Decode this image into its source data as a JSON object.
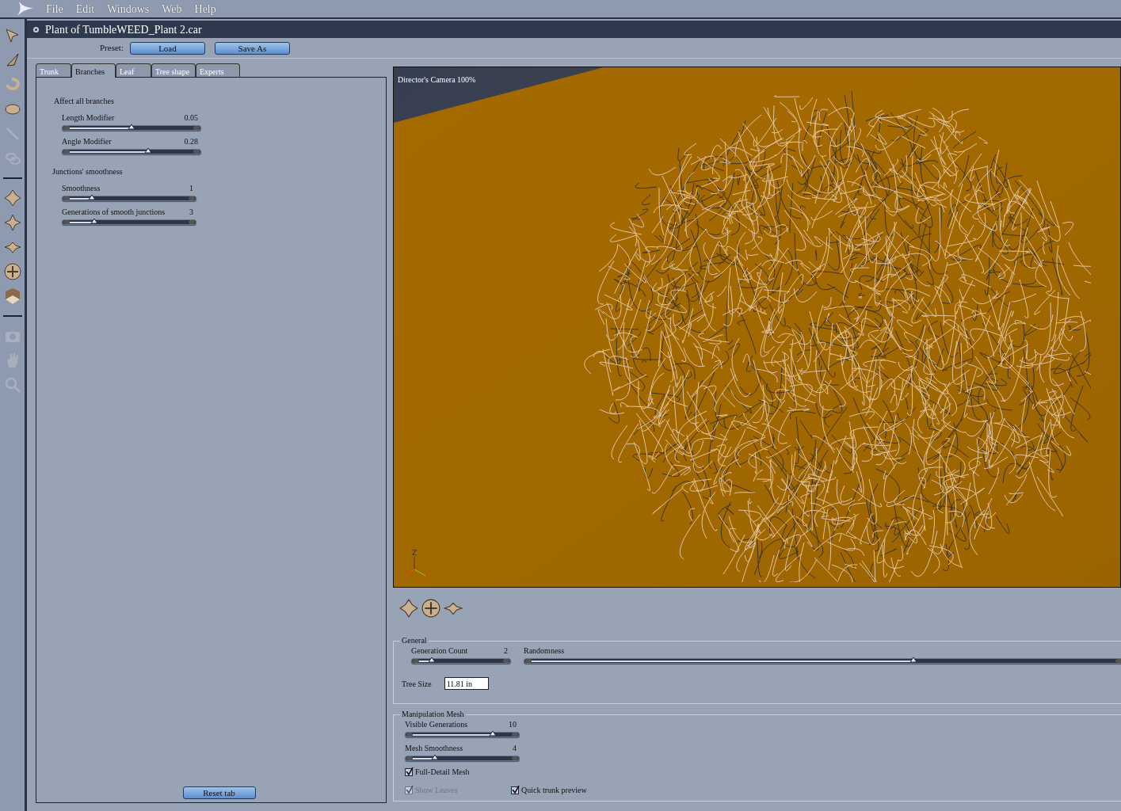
{
  "menu": [
    "File",
    "Edit",
    "Windows",
    "Web",
    "Help"
  ],
  "document": {
    "title": "Plant of TumbleWEED_Plant 2.car"
  },
  "preset": {
    "label": "Preset:",
    "buttons": [
      "Load",
      "Save As"
    ]
  },
  "tabs": [
    {
      "label": "Trunk",
      "selected": false
    },
    {
      "label": "Branches",
      "selected": true
    },
    {
      "label": "Leaf",
      "selected": false
    },
    {
      "label": "Tree shape",
      "selected": false
    },
    {
      "label": "Experts",
      "selected": false
    }
  ],
  "groups": [
    {
      "title": "Affect all branches",
      "sliders": [
        {
          "label": "Length Modifier",
          "reading": "0.05",
          "level": 0.5
        },
        {
          "label": "Angle Modifier",
          "reading": "0.28",
          "level": 0.62
        }
      ]
    },
    {
      "title": "Junctions' smoothness",
      "sliders": [
        {
          "label": "Smoothness",
          "reading": "1",
          "level": 0.22
        },
        {
          "label": "Generations of smooth junctions",
          "reading": "3",
          "level": 0.24
        }
      ]
    }
  ],
  "reset_button": "Reset tab",
  "viewport": {
    "camera_label": "Director's Camera 100%",
    "axis_label": "Z"
  },
  "general": {
    "title": "General",
    "generation_count": {
      "label": "Generation Count",
      "reading": "2",
      "level": 0.2
    },
    "randomness": {
      "label": "Randomness",
      "level": 0.65
    },
    "tree_size": {
      "label": "Tree Size",
      "value": "11.81 in"
    }
  },
  "manipulation_mesh": {
    "title": "Manipulation Mesh",
    "sliders": [
      {
        "label": "Visible Generations",
        "reading": "10",
        "level": 0.77
      },
      {
        "label": "Mesh Smoothness",
        "reading": "4",
        "level": 0.26
      }
    ],
    "checkboxes": [
      {
        "label": "Full-Detail Mesh",
        "checked": true,
        "disabled": false
      },
      {
        "label": "Show Leaves",
        "checked": true,
        "disabled": true
      },
      {
        "label": "Quick trunk preview",
        "checked": true,
        "disabled": false
      }
    ]
  }
}
